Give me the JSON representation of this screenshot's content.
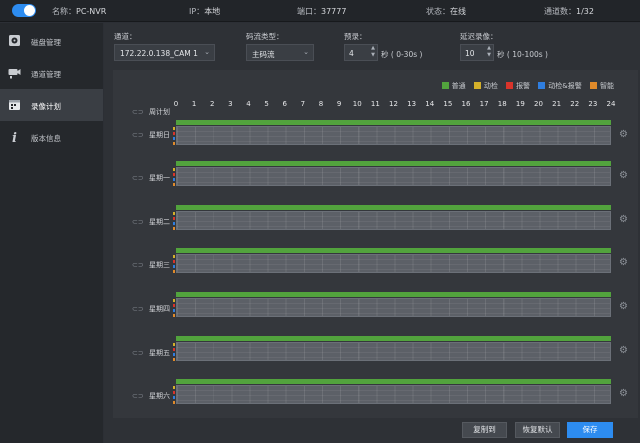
{
  "topbar": {
    "name_label": "名称：",
    "name_value": "PC-NVR",
    "ip_label": "IP：",
    "ip_value": "本地",
    "port_label": "端口：",
    "port_value": "37777",
    "state_label": "状态：",
    "state_value": "在线",
    "channels_label": "通道数：",
    "channels_value": "1/32"
  },
  "sidebar": {
    "items": [
      {
        "label": "磁盘管理",
        "icon": "disk-icon"
      },
      {
        "label": "通道管理",
        "icon": "camera-icon"
      },
      {
        "label": "录像计划",
        "icon": "schedule-icon",
        "active": true
      },
      {
        "label": "版本信息",
        "icon": "info-icon"
      }
    ]
  },
  "form": {
    "channel_label": "通道：",
    "channel_value": "172.22.0.138_CAM 1",
    "stream_label": "码流类型：",
    "stream_value": "主码流",
    "prerecord_label": "预录：",
    "prerecord_value": "4",
    "prerecord_unit": "秒 ( 0-30s )",
    "delay_label": "延迟录像：",
    "delay_value": "10",
    "delay_unit": "秒 ( 10-100s )"
  },
  "legend": [
    {
      "label": "普通",
      "color": "#52a33d"
    },
    {
      "label": "动检",
      "color": "#d4b02a"
    },
    {
      "label": "报警",
      "color": "#d9342b"
    },
    {
      "label": "动检&报警",
      "color": "#2f7ee0"
    },
    {
      "label": "智能",
      "color": "#e08a2a"
    }
  ],
  "schedule": {
    "week_label": "周计划",
    "hours": [
      "0",
      "1",
      "2",
      "3",
      "4",
      "5",
      "6",
      "7",
      "8",
      "9",
      "10",
      "11",
      "12",
      "13",
      "14",
      "15",
      "16",
      "17",
      "18",
      "19",
      "20",
      "21",
      "22",
      "23",
      "24"
    ],
    "days": [
      "星期日",
      "星期一",
      "星期二",
      "星期三",
      "星期四",
      "星期五",
      "星期六"
    ]
  },
  "buttons": {
    "copy": "复制到",
    "restore": "恢复默认",
    "save": "保存"
  }
}
